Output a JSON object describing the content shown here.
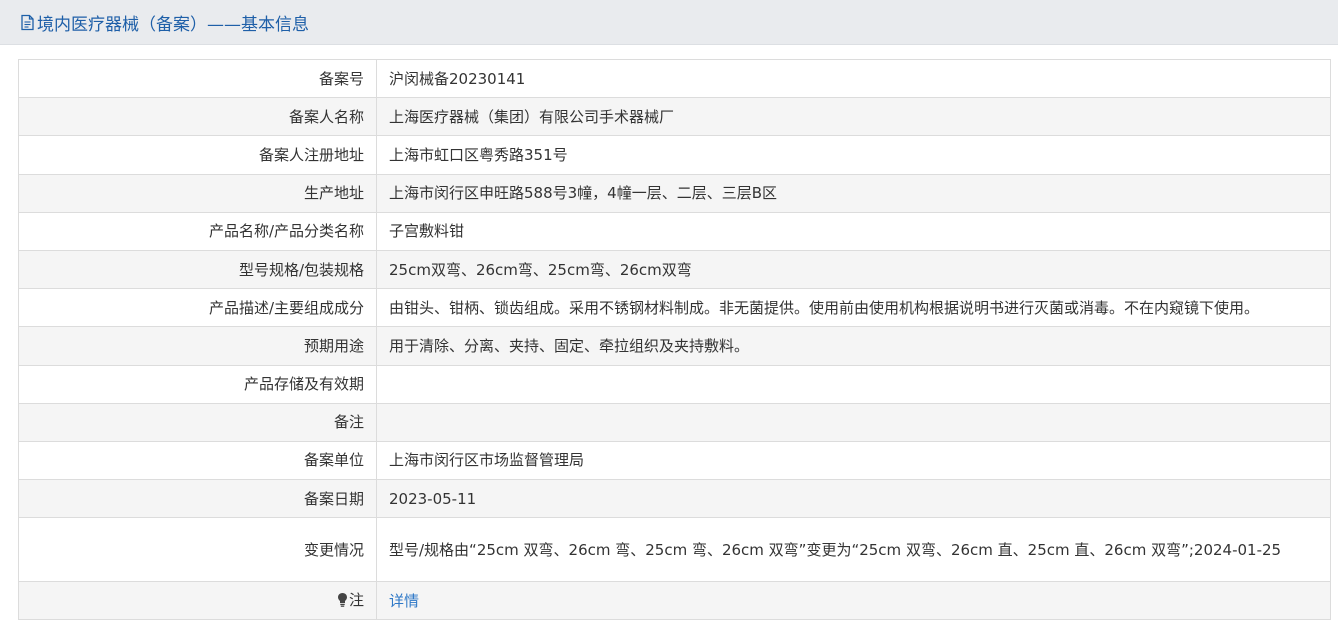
{
  "header": {
    "title": "境内医疗器械（备案）——基本信息",
    "icon": "document-icon"
  },
  "rows": [
    {
      "label": "备案号",
      "value": "沪闵械备20230141"
    },
    {
      "label": "备案人名称",
      "value": "上海医疗器械（集团）有限公司手术器械厂"
    },
    {
      "label": "备案人注册地址",
      "value": "上海市虹口区粤秀路351号"
    },
    {
      "label": "生产地址",
      "value": "上海市闵行区申旺路588号3幢，4幢一层、二层、三层B区"
    },
    {
      "label": "产品名称/产品分类名称",
      "value": "子宫敷料钳"
    },
    {
      "label": "型号规格/包装规格",
      "value": "25cm双弯、26cm弯、25cm弯、26cm双弯"
    },
    {
      "label": "产品描述/主要组成成分",
      "value": "由钳头、钳柄、锁齿组成。采用不锈钢材料制成。非无菌提供。使用前由使用机构根据说明书进行灭菌或消毒。不在内窥镜下使用。"
    },
    {
      "label": "预期用途",
      "value": "用于清除、分离、夹持、固定、牵拉组织及夹持敷料。"
    },
    {
      "label": "产品存储及有效期",
      "value": ""
    },
    {
      "label": "备注",
      "value": ""
    },
    {
      "label": "备案单位",
      "value": "上海市闵行区市场监督管理局"
    },
    {
      "label": "备案日期",
      "value": "2023-05-11"
    },
    {
      "label": "变更情况",
      "value": "型号/规格由“25cm 双弯、26cm 弯、25cm 弯、26cm 双弯”变更为“25cm 双弯、26cm 直、25cm 直、26cm 双弯”;2024-01-25"
    }
  ],
  "note": {
    "label": "注",
    "icon": "lightbulb-icon",
    "link_text": "详情"
  },
  "colors": {
    "title": "#1e5fa8",
    "link": "#2e78c7",
    "header_bg": "#e9ebee",
    "row_alt_bg": "#f5f5f5",
    "border": "#dcdcdc"
  }
}
